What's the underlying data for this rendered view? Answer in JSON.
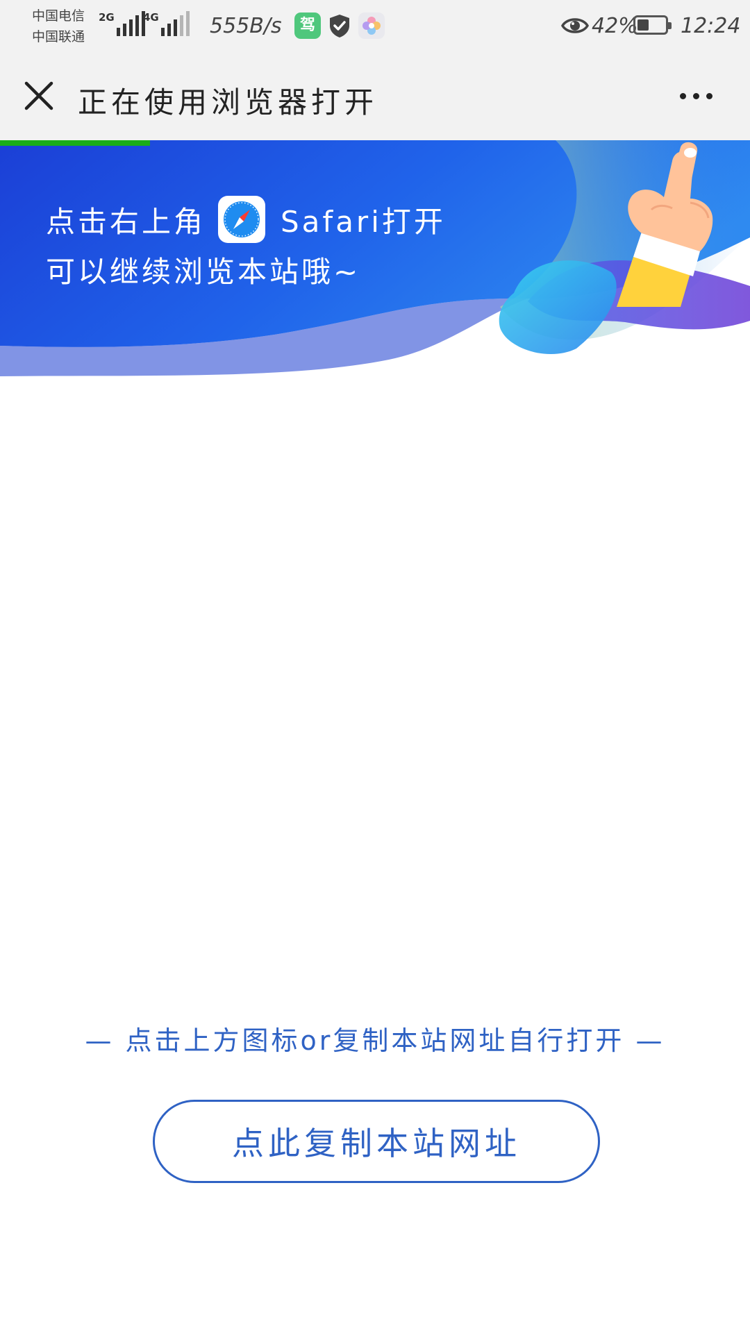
{
  "status_bar": {
    "carrier_1": "中国电信",
    "carrier_2": "中国联通",
    "signal_1_tag": "2G",
    "signal_2_tag": "4G",
    "net_speed": "555B/s",
    "drive_app_glyph": "驾",
    "battery_percent": "42%",
    "battery_level": 0.42,
    "time": "12:24",
    "icons": [
      "signal-bars-icon",
      "drive-app-icon",
      "shield-icon",
      "flower-app-icon",
      "eye-icon",
      "battery-icon"
    ]
  },
  "title_bar": {
    "title": "正在使用浏览器打开",
    "close_icon": "close-icon",
    "more_icon": "more-dots-icon",
    "load_progress": 0.2
  },
  "banner": {
    "line1_prefix": "点击右上角",
    "line1_suffix": "Safari打开",
    "line2": "可以继续浏览本站哦~",
    "icons": [
      "safari-icon",
      "pointing-hand-icon"
    ],
    "colors": {
      "dark_blue": "#1b3fd6",
      "light_blue": "#2f8af0",
      "cyan": "#30c6f0",
      "purple": "#5a3ad8"
    }
  },
  "bottom": {
    "hint": "— 点击上方图标or复制本站网址自行打开 —",
    "copy_button": "点此复制本站网址",
    "accent_color": "#2f62c4"
  }
}
